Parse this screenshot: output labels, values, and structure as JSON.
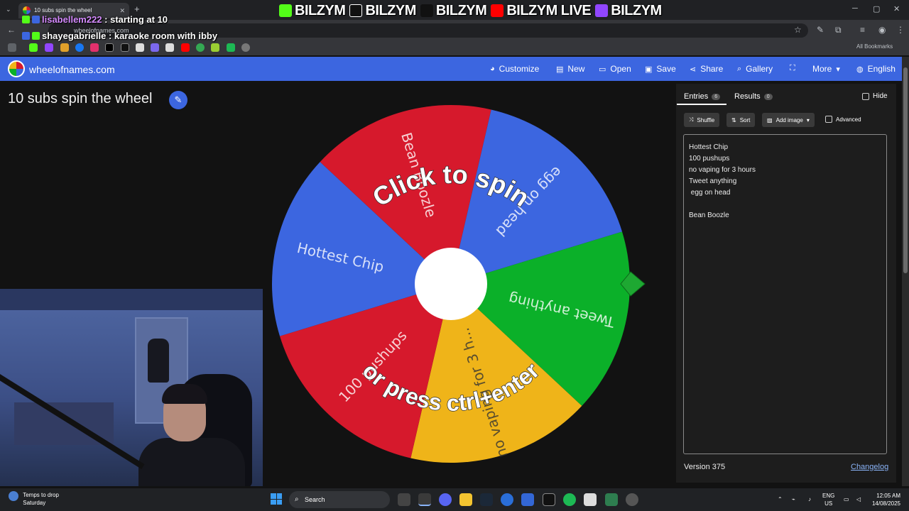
{
  "browser": {
    "tab_title": "10 subs spin the wheel",
    "tab_menu_icon": "chevron-down-icon",
    "new_tab_symbol": "+",
    "url": "wheelofnames.com",
    "all_bookmarks": "All Bookmarks"
  },
  "overlay": {
    "banner": [
      "BILZYM",
      "BILZYM",
      "BILZYM",
      "BILZYM LIVE",
      "BILZYM"
    ],
    "banner_icons": [
      "kick-icon",
      "tiktok-icon",
      "x-icon",
      "youtube-icon",
      "twitch-icon"
    ],
    "chat": [
      {
        "user": "lisabellem222",
        "text": " : starting at 10",
        "user_color": "#d58bff"
      },
      {
        "user": "shayegabrielle",
        "text": " : karaoke room with ibby",
        "user_color": "#ffffff"
      }
    ]
  },
  "site": {
    "name": "wheelofnames.com",
    "nav": [
      {
        "label": "Customize",
        "icon": "palette-icon"
      },
      {
        "label": "New",
        "icon": "file-icon"
      },
      {
        "label": "Open",
        "icon": "folder-icon"
      },
      {
        "label": "Save",
        "icon": "save-icon"
      },
      {
        "label": "Share",
        "icon": "share-icon"
      },
      {
        "label": "Gallery",
        "icon": "search-icon"
      },
      {
        "label": "",
        "icon": "fullscreen-icon"
      },
      {
        "label": "More",
        "icon": "chevron-down-icon"
      },
      {
        "label": "English",
        "icon": "globe-icon"
      }
    ],
    "accent": "#3c66e0"
  },
  "wheel": {
    "title": "10 subs spin the wheel",
    "overlay_top": "Click to spin",
    "overlay_bottom": "or press ctrl+enter",
    "segments": [
      {
        "label": "Tweet anything",
        "color": "#0bb029"
      },
      {
        "label": "no vaping for 3 h...",
        "color": "#efb419"
      },
      {
        "label": "100 pushups",
        "color": "#d6192c"
      },
      {
        "label": "Hottest Chip",
        "color": "#3c66e0"
      },
      {
        "label": "Bean Boozle",
        "color": "#d6192c"
      },
      {
        "label": "egg on head",
        "color": "#3c66e0"
      }
    ],
    "pointer_color": "#1ea832"
  },
  "panel": {
    "tabs": [
      {
        "label": "Entries",
        "count": "6"
      },
      {
        "label": "Results",
        "count": "0"
      }
    ],
    "hide_label": "Hide",
    "tools": [
      {
        "label": "Shuffle",
        "icon": "shuffle-icon"
      },
      {
        "label": "Sort",
        "icon": "sort-icon"
      },
      {
        "label": "Add image",
        "icon": "image-icon"
      }
    ],
    "advanced_label": "Advanced",
    "entries": [
      "Hottest Chip",
      "100 pushups",
      "no vaping for 3 hours",
      "Tweet anything",
      " egg on head",
      "",
      "Bean Boozle"
    ],
    "version": "Version 375",
    "changelog": "Changelog"
  },
  "taskbar": {
    "weather_line1": "Temps to drop",
    "weather_line2": "Saturday",
    "search_label": "Search",
    "lang_line1": "ENG",
    "lang_line2": "US",
    "time": "12:05 AM",
    "date": "14/08/2025"
  }
}
